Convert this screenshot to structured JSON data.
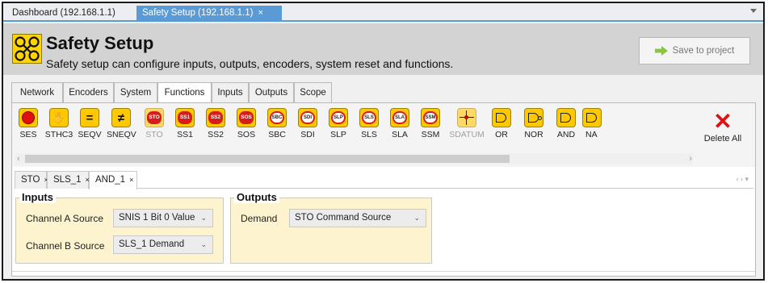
{
  "doc_tabs": [
    {
      "label": "Dashboard (192.168.1.1)"
    },
    {
      "label": "Safety Setup (192.168.1.1)",
      "close": "×"
    }
  ],
  "header": {
    "title": "Safety Setup",
    "subtitle": "Safety setup can configure inputs, outputs, encoders, system reset and functions.",
    "save_label": "Save to project"
  },
  "category_tabs": [
    "Network",
    "Encoders",
    "System",
    "Functions",
    "Inputs",
    "Outputs",
    "Scope"
  ],
  "active_category": "Functions",
  "functions": [
    {
      "label": "SES",
      "icon": "estop-icon"
    },
    {
      "label": "STHC3",
      "icon": "hand-icon"
    },
    {
      "label": "SEQV",
      "icon": "equals-icon",
      "glyph": "="
    },
    {
      "label": "SNEQV",
      "icon": "not-equal-icon",
      "glyph": "≠"
    },
    {
      "label": "STO",
      "icon": "sto-icon",
      "badge": "STO",
      "dim": true
    },
    {
      "label": "SS1",
      "icon": "ss1-icon",
      "badge": "SS1"
    },
    {
      "label": "SS2",
      "icon": "ss2-icon",
      "badge": "SS2"
    },
    {
      "label": "SOS",
      "icon": "sos-icon",
      "badge": "SOS"
    },
    {
      "label": "SBC",
      "icon": "sbc-icon",
      "badge_w": "SBC"
    },
    {
      "label": "SDI",
      "icon": "sdi-icon",
      "badge_w": "SDI"
    },
    {
      "label": "SLP",
      "icon": "slp-icon",
      "badge_w": "SLP"
    },
    {
      "label": "SLS",
      "icon": "sls-icon",
      "badge_w": "SLS"
    },
    {
      "label": "SLA",
      "icon": "sla-icon",
      "badge_w": "SLA"
    },
    {
      "label": "SSM",
      "icon": "ssm-icon",
      "badge_w": "SSM"
    },
    {
      "label": "SDATUM",
      "icon": "datum-icon",
      "dim": true
    },
    {
      "label": "OR",
      "icon": "or-gate-icon"
    },
    {
      "label": "NOR",
      "icon": "nor-gate-icon"
    },
    {
      "label": "AND",
      "icon": "and-gate-icon"
    },
    {
      "label": "NA",
      "icon": "nand-gate-icon"
    }
  ],
  "delete_all": {
    "label": "Delete All",
    "glyph": "✕"
  },
  "sub_tabs": [
    {
      "label": "STO",
      "close": "×"
    },
    {
      "label": "SLS_1",
      "close": "×"
    },
    {
      "label": "AND_1",
      "close": "×"
    }
  ],
  "inputs": {
    "title": "Inputs",
    "channel_a_label": "Channel A Source",
    "channel_a_value": "SNIS 1 Bit 0 Value",
    "channel_b_label": "Channel B Source",
    "channel_b_value": "SLS_1 Demand"
  },
  "outputs": {
    "title": "Outputs",
    "demand_label": "Demand",
    "demand_value": "STO Command Source"
  },
  "colors": {
    "accent": "#5b9bd5",
    "icon_fill": "#ffc800",
    "group_fill": "#fdf4cf",
    "delete": "#e01010"
  }
}
